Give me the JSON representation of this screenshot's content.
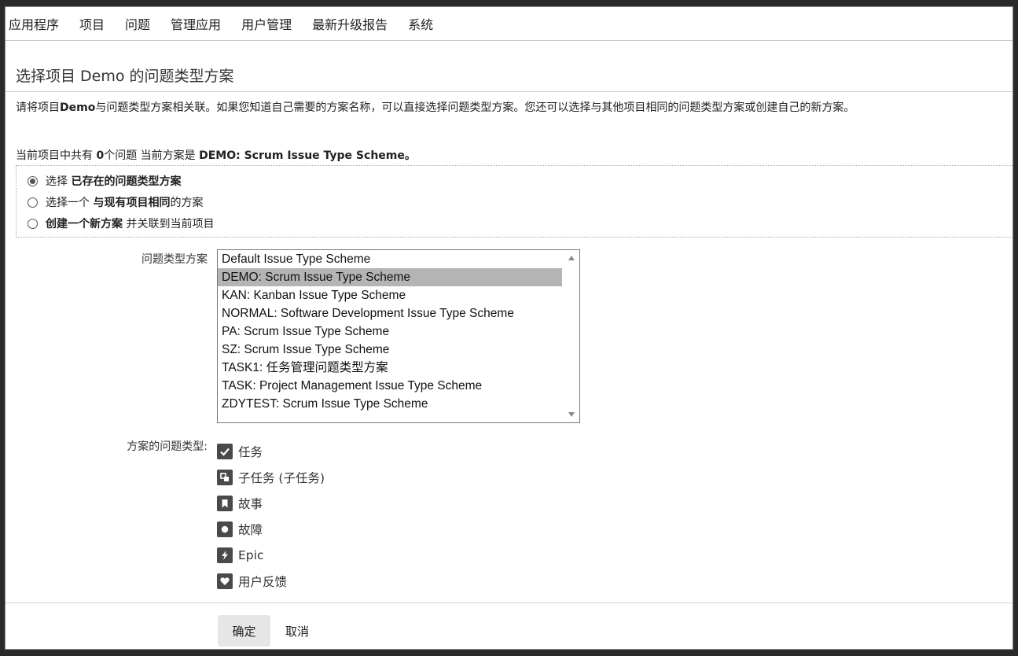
{
  "menu": {
    "items": [
      "应用程序",
      "项目",
      "问题",
      "管理应用",
      "用户管理",
      "最新升级报告",
      "系统"
    ]
  },
  "page": {
    "title": "选择项目 Demo 的问题类型方案",
    "desc_prefix": "请将项目",
    "desc_project": "Demo",
    "desc_rest": "与问题类型方案相关联。如果您知道自己需要的方案名称，可以直接选择问题类型方案。您还可以选择与其他项目相同的问题类型方案或创建自己的新方案。",
    "status_prefix": "当前项目中共有 ",
    "status_count": "0",
    "status_mid": "个问题 当前方案是 ",
    "status_scheme": "DEMO: Scrum Issue Type Scheme",
    "status_end": "。"
  },
  "radios": [
    {
      "pre": "选择 ",
      "bold": "已存在的问题类型方案",
      "post": "",
      "checked": true
    },
    {
      "pre": "选择一个 ",
      "bold": "与现有项目相同",
      "post": "的方案",
      "checked": false
    },
    {
      "pre": "",
      "bold": "创建一个新方案",
      "post": " 并关联到当前项目",
      "checked": false
    }
  ],
  "scheme_select": {
    "label": "问题类型方案",
    "selected_index": 1,
    "options": [
      "Default Issue Type Scheme",
      "DEMO: Scrum Issue Type Scheme",
      "KAN: Kanban Issue Type Scheme",
      "NORMAL: Software Development Issue Type Scheme",
      "PA: Scrum Issue Type Scheme",
      "SZ: Scrum Issue Type Scheme",
      "TASK1: 任务管理问题类型方案",
      "TASK: Project Management Issue Type Scheme",
      "ZDYTEST: Scrum Issue Type Scheme"
    ]
  },
  "issue_types": {
    "label": "方案的问题类型:",
    "items": [
      {
        "name": "任务",
        "icon": "task-check-icon"
      },
      {
        "name": "子任务 (子任务)",
        "icon": "subtask-icon"
      },
      {
        "name": "故事",
        "icon": "story-bookmark-icon"
      },
      {
        "name": "故障",
        "icon": "bug-icon"
      },
      {
        "name": "Epic",
        "icon": "epic-lightning-icon"
      },
      {
        "name": "用户反馈",
        "icon": "feedback-heart-icon"
      }
    ]
  },
  "buttons": {
    "ok": "确定",
    "cancel": "取消"
  },
  "colors": {
    "selected_option": "#b4b4b4",
    "icon_bg": "#4a4a4a"
  }
}
